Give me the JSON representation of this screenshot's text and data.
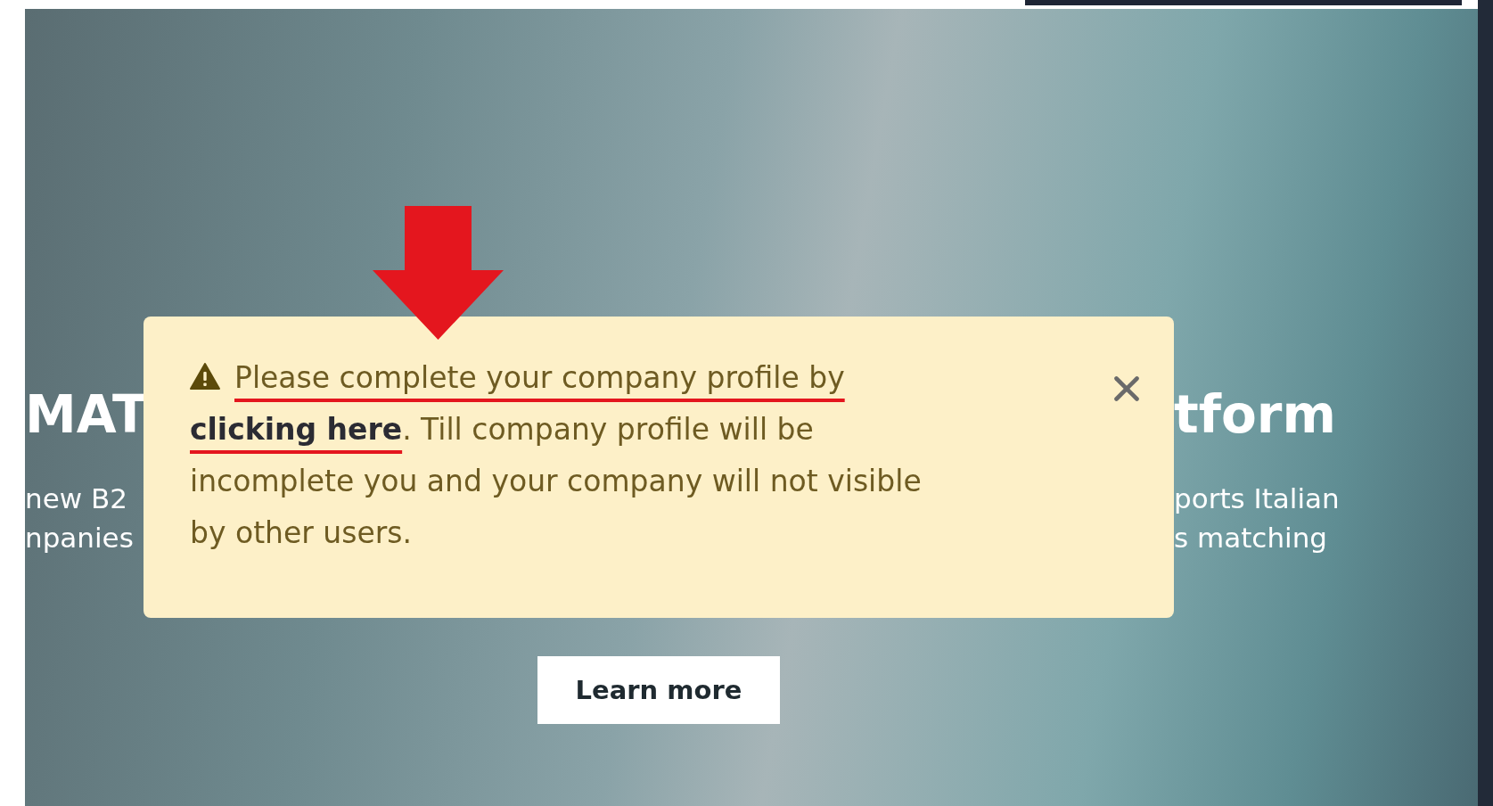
{
  "hero": {
    "heading_left": "MAT",
    "heading_right": "tform",
    "subtitle_left": [
      "new B2",
      "npanies"
    ],
    "subtitle_right": [
      "ports Italian",
      "s matching"
    ],
    "button": "Learn more"
  },
  "alert": {
    "segments": [
      {
        "kind": "underlined",
        "text": "Please complete your company profile by "
      },
      {
        "kind": "link",
        "text": "clicking here"
      },
      {
        "kind": "plain",
        "text": ". Till company profile will be incomplete you and your company will not visible by other users."
      }
    ]
  }
}
